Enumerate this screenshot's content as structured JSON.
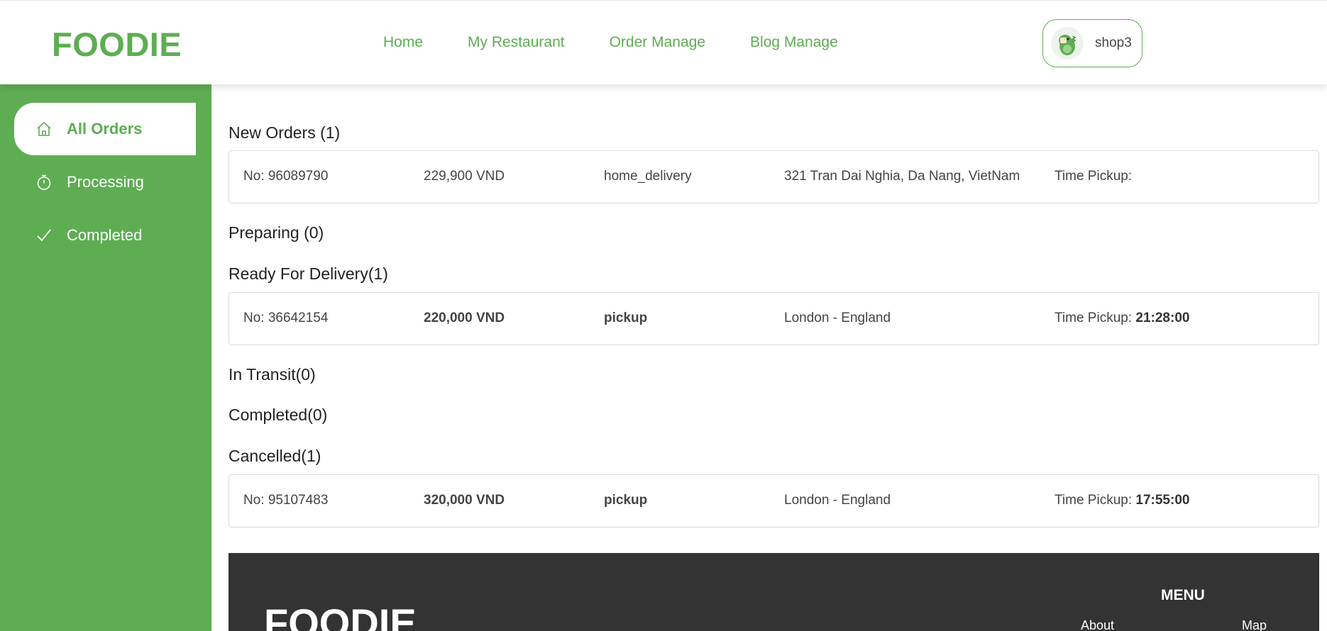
{
  "brand": "FOODIE",
  "nav": [
    "Home",
    "My Restaurant",
    "Order Manage",
    "Blog Manage"
  ],
  "user": {
    "name": "shop3",
    "avatar_icon": "dinosaur-avatar"
  },
  "sidebar": [
    {
      "label": "All Orders",
      "icon": "home-icon",
      "active": true
    },
    {
      "label": "Processing",
      "icon": "timer-icon",
      "active": false
    },
    {
      "label": "Completed",
      "icon": "check-icon",
      "active": false
    }
  ],
  "sections": {
    "new": {
      "title": "New Orders (1)",
      "orders": [
        {
          "no": "No: 96089790",
          "price": "229,900 VND",
          "type": "home_delivery",
          "address": "321 Tran Dai Nghia, Da Nang, VietNam",
          "time_label": "Time Pickup:",
          "time": ""
        }
      ]
    },
    "preparing": {
      "title": "Preparing (0)"
    },
    "ready": {
      "title": "Ready For Delivery(1)",
      "orders": [
        {
          "no": "No: 36642154",
          "price": "220,000 VND",
          "type": "pickup",
          "address": "London - England",
          "time_label": "Time Pickup:",
          "time": "21:28:00"
        }
      ]
    },
    "transit": {
      "title": "In Transit(0)"
    },
    "completed": {
      "title": "Completed(0)"
    },
    "cancelled": {
      "title": "Cancelled(1)",
      "orders": [
        {
          "no": "No: 95107483",
          "price": "320,000 VND",
          "type": "pickup",
          "address": "London - England",
          "time_label": "Time Pickup:",
          "time": "17:55:00"
        }
      ]
    }
  },
  "footer": {
    "logo": "FOODIE",
    "menu_title": "MENU",
    "links": [
      "About",
      "Map"
    ]
  },
  "colors": {
    "accent": "#5ead53",
    "footer_bg": "#333333"
  }
}
